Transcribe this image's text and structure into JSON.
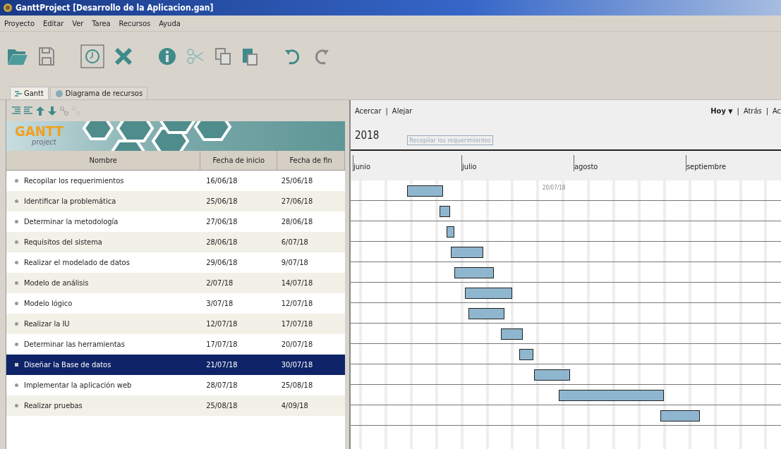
{
  "window": {
    "title": "GanttProject [Desarrollo de la Aplicacion.gan]"
  },
  "menu": [
    "Proyecto",
    "Editar",
    "Ver",
    "Tarea",
    "Recursos",
    "Ayuda"
  ],
  "tabs": [
    {
      "label": "Gantt",
      "selected": true
    },
    {
      "label": "Diagrama de recursos",
      "selected": false
    }
  ],
  "logo": {
    "main": "GANTT",
    "sub": "project"
  },
  "table": {
    "columns": [
      "Nombre",
      "Fecha de inicio",
      "Fecha de fin"
    ],
    "rows": [
      {
        "name": "Recopilar los requerimientos",
        "start": "16/06/18",
        "end": "25/06/18",
        "selected": false
      },
      {
        "name": "Identificar la problemática",
        "start": "25/06/18",
        "end": "27/06/18",
        "selected": false
      },
      {
        "name": "Determinar la metodología",
        "start": "27/06/18",
        "end": "28/06/18",
        "selected": false
      },
      {
        "name": "Requisitos del sistema",
        "start": "28/06/18",
        "end": "6/07/18",
        "selected": false
      },
      {
        "name": "Realizar el modelado de datos",
        "start": "29/06/18",
        "end": "9/07/18",
        "selected": false
      },
      {
        "name": "Modelo de análisis",
        "start": "2/07/18",
        "end": "14/07/18",
        "selected": false
      },
      {
        "name": "Modelo lógico",
        "start": "3/07/18",
        "end": "12/07/18",
        "selected": false
      },
      {
        "name": "Realizar la IU",
        "start": "12/07/18",
        "end": "17/07/18",
        "selected": false
      },
      {
        "name": "Determinar las herramientas",
        "start": "17/07/18",
        "end": "20/07/18",
        "selected": false
      },
      {
        "name": "Diseñar la Base de datos",
        "start": "21/07/18",
        "end": "30/07/18",
        "selected": true
      },
      {
        "name": "Implementar la aplicación web",
        "start": "28/07/18",
        "end": "25/08/18",
        "selected": false
      },
      {
        "name": "Realizar pruebas",
        "start": "25/08/18",
        "end": "4/09/18",
        "selected": false
      }
    ]
  },
  "chart_header": {
    "zoom_in": "Acercar",
    "zoom_out": "Alejar",
    "today": "Hoy",
    "today_caret": "▼",
    "back": "Atrás",
    "forward": "Ac",
    "separators": [
      "|",
      "|",
      "|"
    ]
  },
  "timeline": {
    "year": "2018",
    "tooltip": "Recopilar los requerimientos",
    "months": [
      "junio",
      "julio",
      "agosto",
      "septiembre"
    ],
    "today_label": "20/07/18"
  }
}
